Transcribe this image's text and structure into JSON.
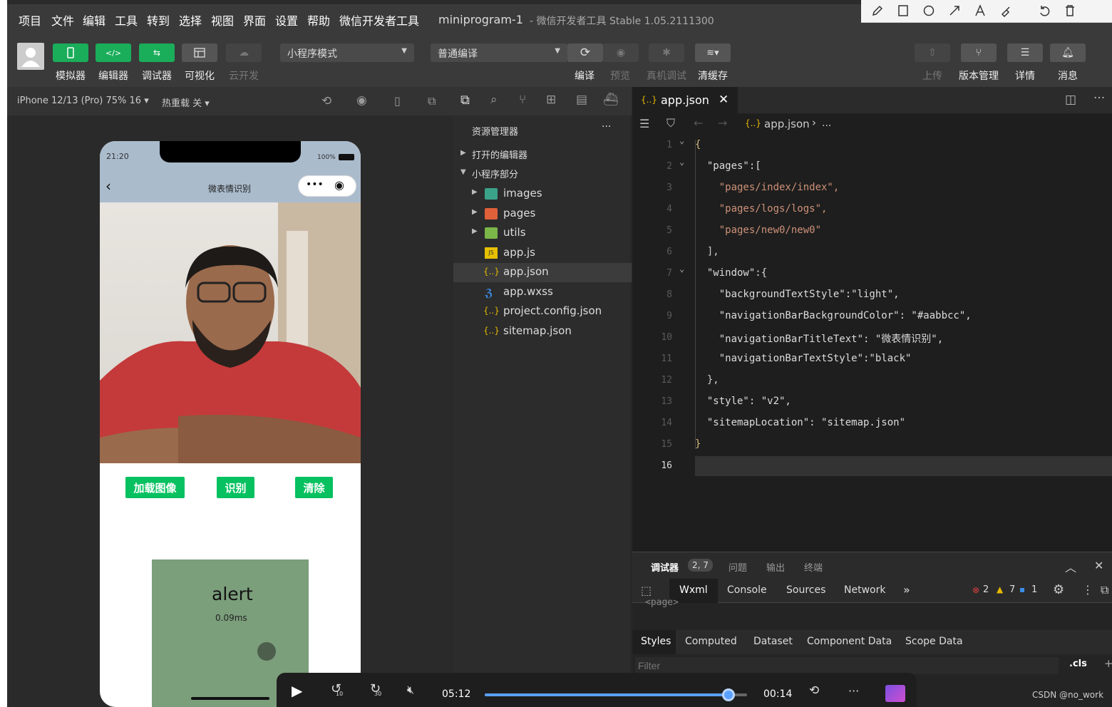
{
  "menu": {
    "items": [
      "项目",
      "文件",
      "编辑",
      "工具",
      "转到",
      "选择",
      "视图",
      "界面",
      "设置",
      "帮助",
      "微信开发者工具"
    ],
    "project_name": "miniprogram-1",
    "app_title": "- 微信开发者工具 Stable 1.05.2111300"
  },
  "toolbar": {
    "simulator": "模拟器",
    "editor": "编辑器",
    "debugger": "调试器",
    "visual": "可视化",
    "cloud": "云开发",
    "mode_select": "小程序模式",
    "compile_select": "普通编译",
    "compile": "编译",
    "preview": "预览",
    "remote_debug": "真机调试",
    "clear_cache": "清缓存",
    "upload": "上传",
    "version": "版本管理",
    "details": "详情",
    "messages": "消息"
  },
  "simulator": {
    "device": "iPhone 12/13 (Pro) 75% 16 ▾",
    "hot_reload": "热重载 关 ▾",
    "time": "21:20",
    "battery": "100%",
    "nav_title": "微表情识别",
    "buttons": [
      "加载图像",
      "识别",
      "清除"
    ],
    "alert_title": "alert",
    "alert_time": "0.09ms",
    "colors": {
      "nav_bg": "#aabbcc",
      "button": "#07c160"
    }
  },
  "explorer": {
    "title": "资源管理器",
    "more": "···",
    "open_editors": "打开的编辑器",
    "section": "小程序部分",
    "items": [
      {
        "name": "images",
        "type": "folder"
      },
      {
        "name": "pages",
        "type": "folder"
      },
      {
        "name": "utils",
        "type": "folder"
      },
      {
        "name": "app.js",
        "type": "js"
      },
      {
        "name": "app.json",
        "type": "json",
        "selected": true
      },
      {
        "name": "app.wxss",
        "type": "wxss"
      },
      {
        "name": "project.config.json",
        "type": "json"
      },
      {
        "name": "sitemap.json",
        "type": "json"
      }
    ]
  },
  "editor": {
    "tab_name": "app.json",
    "breadcrumb": "app.json",
    "breadcrumb_more": "...",
    "lines": [
      {
        "n": "1",
        "t": "{"
      },
      {
        "n": "2",
        "t": "  \"pages\":["
      },
      {
        "n": "3",
        "t": "    \"pages/index/index\","
      },
      {
        "n": "4",
        "t": "    \"pages/logs/logs\","
      },
      {
        "n": "5",
        "t": "    \"pages/new0/new0\""
      },
      {
        "n": "6",
        "t": "  ],"
      },
      {
        "n": "7",
        "t": "  \"window\":{"
      },
      {
        "n": "8",
        "t": "    \"backgroundTextStyle\":\"light\","
      },
      {
        "n": "9",
        "t": "    \"navigationBarBackgroundColor\": \"#aabbcc\","
      },
      {
        "n": "10",
        "t": "    \"navigationBarTitleText\": \"微表情识别\","
      },
      {
        "n": "11",
        "t": "    \"navigationBarTextStyle\":\"black\""
      },
      {
        "n": "12",
        "t": "  },"
      },
      {
        "n": "13",
        "t": "  \"style\": \"v2\","
      },
      {
        "n": "14",
        "t": "  \"sitemapLocation\": \"sitemap.json\""
      },
      {
        "n": "15",
        "t": "}"
      },
      {
        "n": "16",
        "t": ""
      }
    ]
  },
  "debugger": {
    "tabs": [
      "调试器",
      "问题",
      "输出",
      "终端"
    ],
    "badge": "2, 7",
    "panels": [
      "Wxml",
      "Console",
      "Sources",
      "Network"
    ],
    "more": "»",
    "errors": "2",
    "warnings": "7",
    "infos": "1",
    "wxml_snippet": "<page>",
    "style_tabs": [
      "Styles",
      "Computed",
      "Dataset",
      "Component Data",
      "Scope Data"
    ],
    "filter_placeholder": "Filter",
    "cls": ".cls",
    "plus": "+"
  },
  "player": {
    "elapsed": "05:12",
    "remaining": "00:14",
    "progress": 0.93,
    "back_seconds": "10",
    "forward_seconds": "30"
  },
  "watermark": "CSDN @no_work"
}
